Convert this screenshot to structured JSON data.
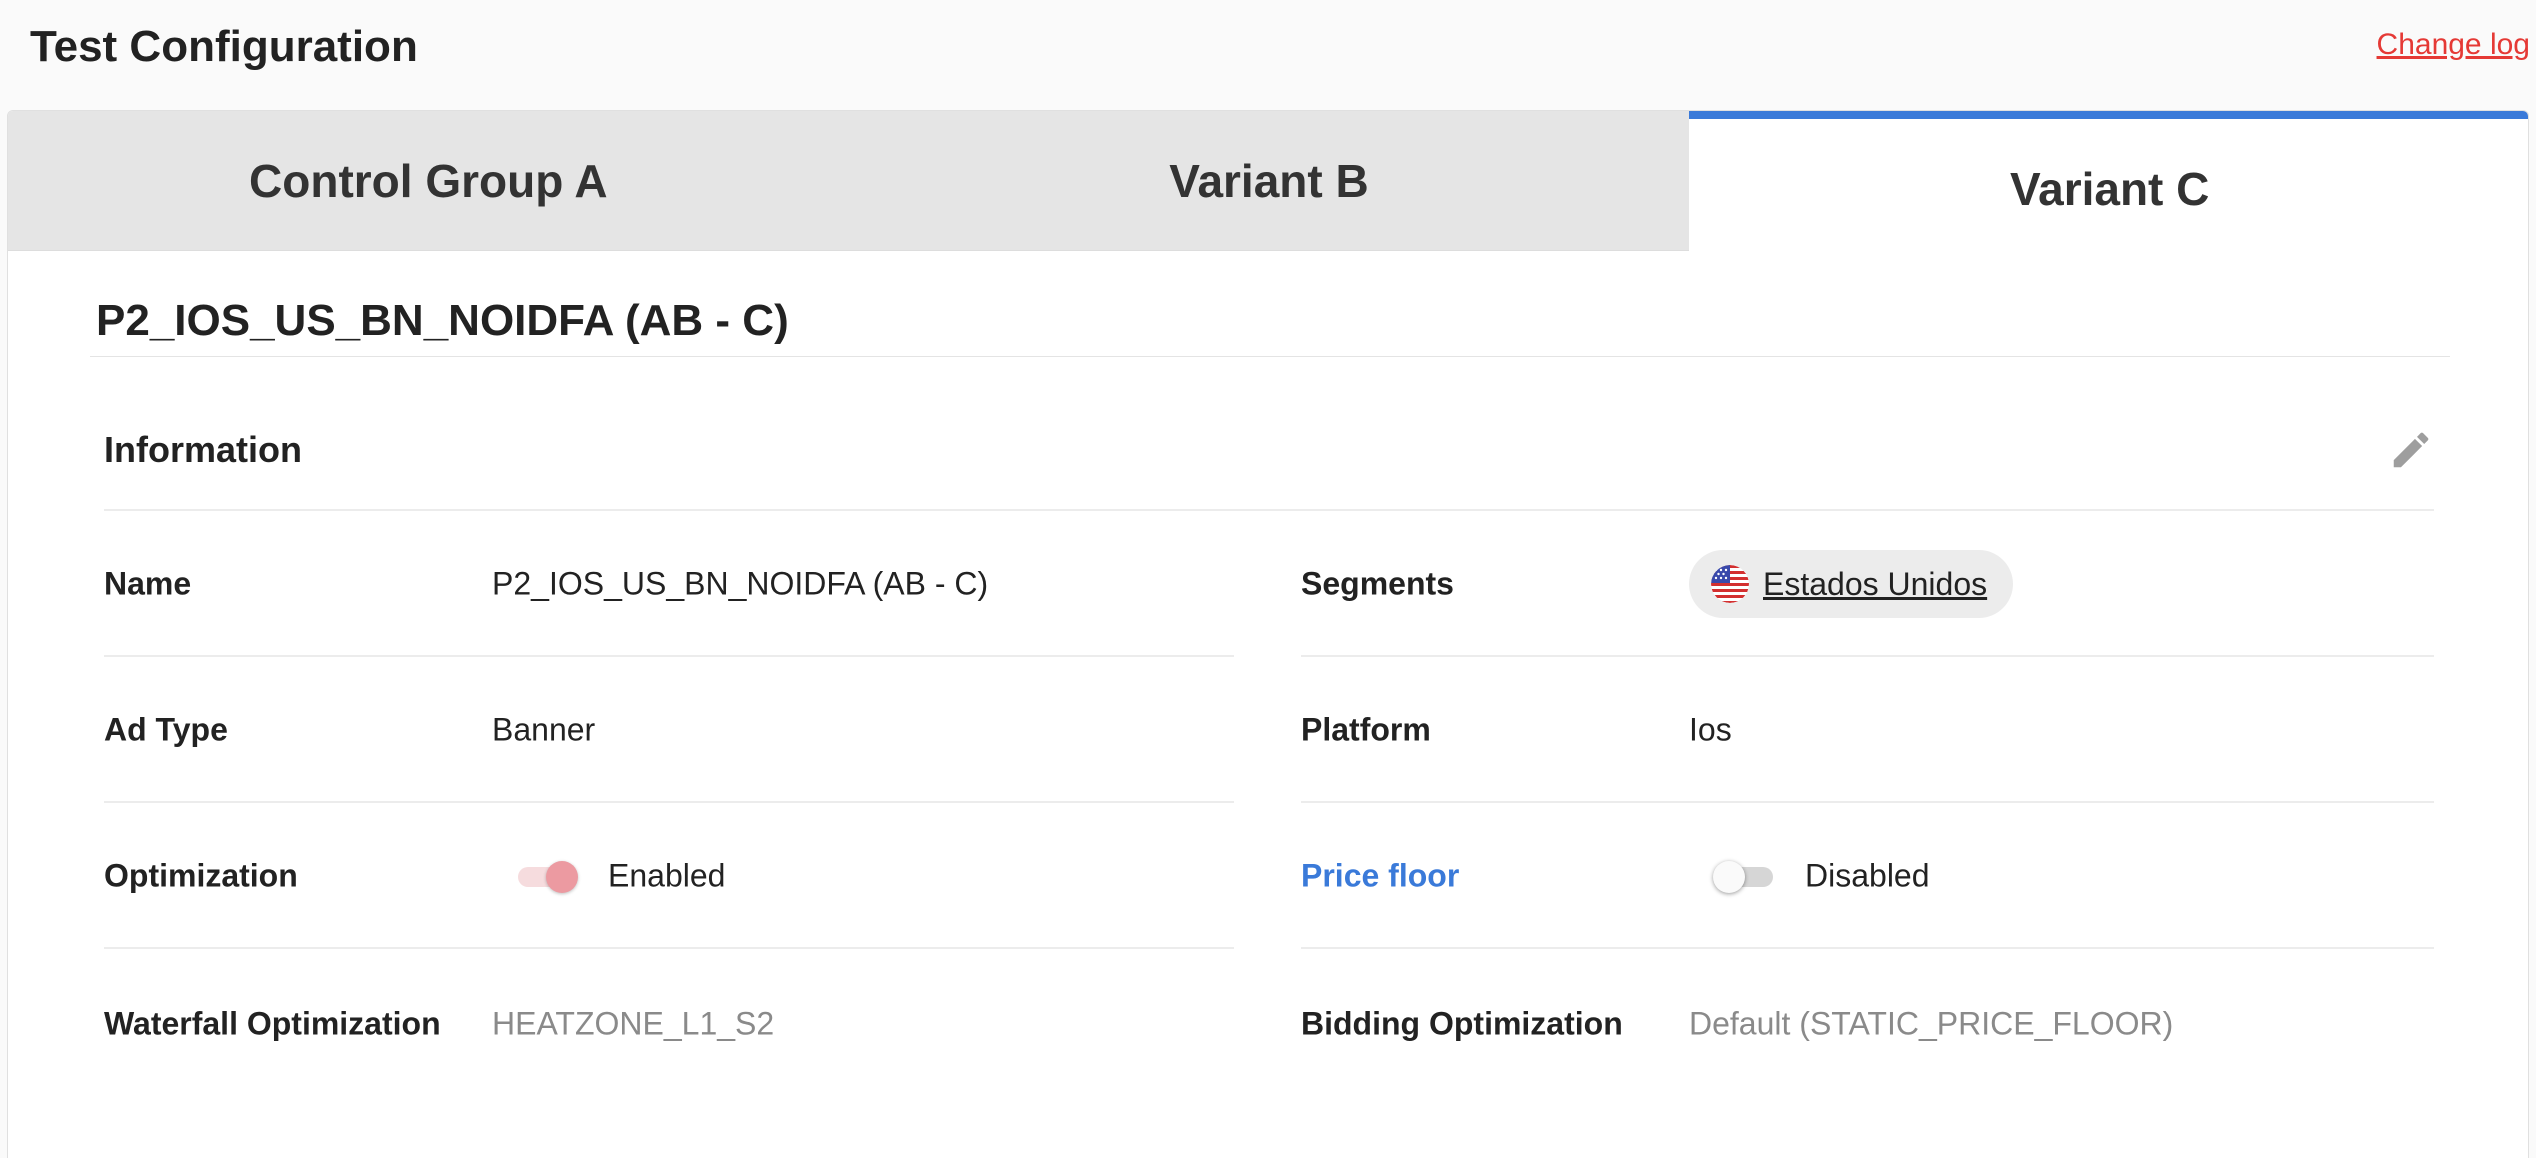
{
  "header": {
    "title": "Test Configuration",
    "change_log": "Change log"
  },
  "tabs": [
    {
      "label": "Control Group A",
      "active": false
    },
    {
      "label": "Variant B",
      "active": false
    },
    {
      "label": "Variant C",
      "active": true
    }
  ],
  "variant": {
    "title": "P2_IOS_US_BN_NOIDFA (AB - C)"
  },
  "information": {
    "section_title": "Information",
    "edit_icon": "pencil-icon",
    "left": {
      "name": {
        "label": "Name",
        "value": "P2_IOS_US_BN_NOIDFA (AB - C)"
      },
      "ad_type": {
        "label": "Ad Type",
        "value": "Banner"
      },
      "optimization": {
        "label": "Optimization",
        "state": "Enabled",
        "on": true
      },
      "waterfall": {
        "label": "Waterfall Optimization",
        "value": "HEATZONE_L1_S2"
      }
    },
    "right": {
      "segments": {
        "label": "Segments",
        "chip": "Estados Unidos",
        "chip_icon": "us-flag-icon"
      },
      "platform": {
        "label": "Platform",
        "value": "Ios"
      },
      "price_floor": {
        "label": "Price floor",
        "state": "Disabled",
        "on": false
      },
      "bidding": {
        "label": "Bidding Optimization",
        "value": "Default (STATIC_PRICE_FLOOR)"
      }
    }
  },
  "colors": {
    "accent": "#3a7ad9",
    "danger": "#e53935",
    "toggle_on": "#ec9aa1"
  }
}
